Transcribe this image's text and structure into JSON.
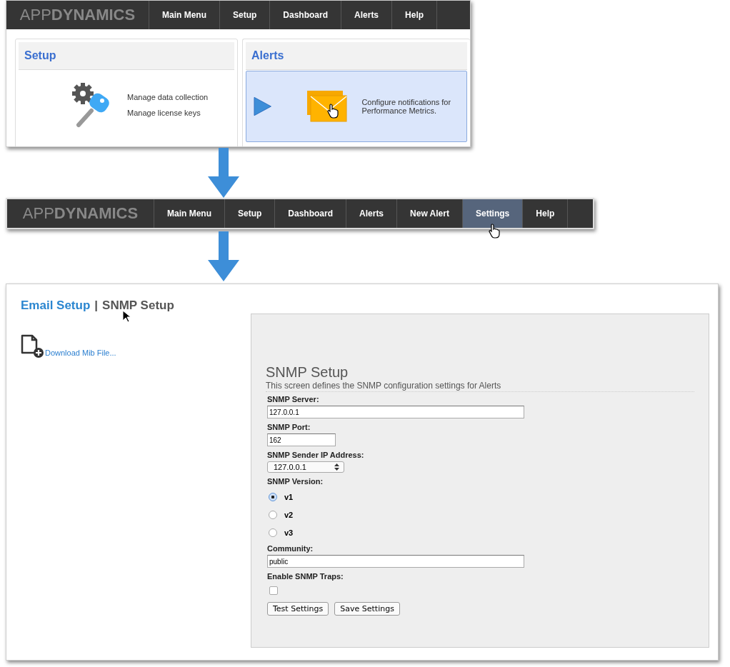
{
  "home_screen": {
    "logo": "APP**DYNAMICS**",
    "nav": [
      {
        "label": "Main Menu",
        "selected": false
      },
      {
        "label": "Setup",
        "selected": false
      },
      {
        "label": "Dashboard",
        "selected": false
      },
      {
        "label": "Alerts",
        "selected": false
      },
      {
        "label": "Help",
        "selected": false
      }
    ],
    "cards": [
      {
        "kind": "setup",
        "title": "Setup",
        "highlighted": false,
        "lines": [
          "Manage data collection",
          "Manage license keys"
        ]
      },
      {
        "kind": "alerts",
        "title": "Alerts",
        "highlighted": true,
        "lines": [
          "Configure notifications for Performance Metrics."
        ]
      }
    ]
  },
  "alerts_nav": {
    "logo": "APP**DYNAMICS**",
    "nav": [
      {
        "label": "Main Menu",
        "selected": false
      },
      {
        "label": "Setup",
        "selected": false
      },
      {
        "label": "Dashboard",
        "selected": false
      },
      {
        "label": "Alerts",
        "selected": false
      },
      {
        "label": "New Alert",
        "selected": false
      },
      {
        "label": "Settings",
        "selected": true
      },
      {
        "label": "Help",
        "selected": false
      }
    ]
  },
  "settings_page": {
    "tabs": [
      {
        "label": "Email Setup",
        "selected": false
      },
      {
        "label": "SNMP Setup",
        "selected": true
      }
    ],
    "separator": "|",
    "download_link": "Download Mib File...",
    "form": {
      "title": "SNMP Setup",
      "subtitle": "This screen defines the SNMP configuration settings for Alerts",
      "fields": [
        {
          "kind": "text",
          "label": "SNMP Server:",
          "value": "127.0.0.1"
        },
        {
          "kind": "number",
          "label": "SNMP Port:",
          "value": "162"
        },
        {
          "kind": "select",
          "label": "SNMP Sender IP Address:",
          "value": "127.0.0.1"
        },
        {
          "kind": "radio",
          "label": "SNMP Version:",
          "options": [
            {
              "label": "v1",
              "selected": true
            },
            {
              "label": "v2",
              "selected": false
            },
            {
              "label": "v3",
              "selected": false
            }
          ]
        },
        {
          "kind": "text",
          "label": "Community:",
          "value": "public"
        },
        {
          "kind": "checkbox",
          "label": "Enable SNMP Traps:",
          "checked": false
        }
      ],
      "buttons": [
        "Test Settings",
        "Save Settings"
      ]
    }
  }
}
